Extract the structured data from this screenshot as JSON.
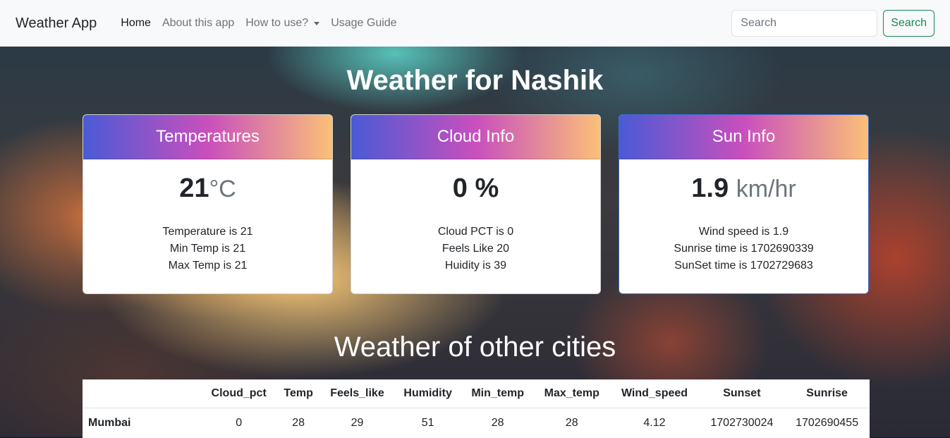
{
  "navbar": {
    "brand": "Weather App",
    "links": [
      "Home",
      "About this app",
      "How to use?",
      "Usage Guide"
    ],
    "search_placeholder": "Search",
    "search_button": "Search"
  },
  "title": "Weather for Nashik",
  "cards": [
    {
      "header": "Temperatures",
      "main_value": "21",
      "unit": "°C",
      "lines": [
        "Temperature is 21",
        "Min Temp is 21",
        "Max Temp is 21"
      ]
    },
    {
      "header": "Cloud Info",
      "main_value": "0 %",
      "unit": "",
      "lines": [
        "Cloud PCT is 0",
        "Feels Like 20",
        "Huidity is 39"
      ]
    },
    {
      "header": "Sun Info",
      "main_value": "1.9",
      "unit": "km/hr",
      "lines": [
        "Wind speed is 1.9",
        "Sunrise time is 1702690339",
        "SunSet time is 1702729683"
      ]
    }
  ],
  "subtitle": "Weather of other cities",
  "table": {
    "headers": [
      "",
      "Cloud_pct",
      "Temp",
      "Feels_like",
      "Humidity",
      "Min_temp",
      "Max_temp",
      "Wind_speed",
      "Sunset",
      "Sunrise"
    ],
    "rows": [
      [
        "Mumbai",
        "0",
        "28",
        "29",
        "51",
        "28",
        "28",
        "4.12",
        "1702730024",
        "1702690455"
      ]
    ]
  }
}
